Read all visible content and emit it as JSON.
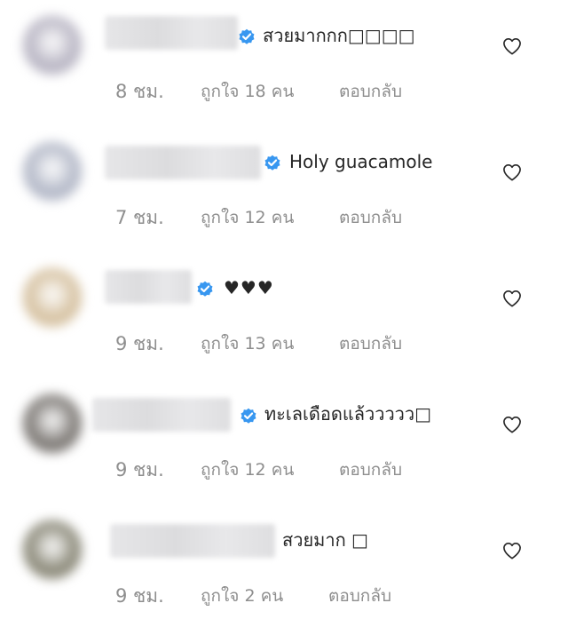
{
  "top_partial_text": "",
  "comments": [
    {
      "text": "สวยมากกก□□□□",
      "verified": true,
      "time": "8 ชม.",
      "likes": "ถูกใจ 18 คน",
      "reply": "ตอบกลับ",
      "avatar_color": "#b9b6c4"
    },
    {
      "text": "Holy guacamole",
      "verified": true,
      "time": "7 ชม.",
      "likes": "ถูกใจ 12 คน",
      "reply": "ตอบกลับ",
      "avatar_color": "#b4b9c8"
    },
    {
      "text": "♥♥♥",
      "verified": true,
      "time": "9 ชม.",
      "likes": "ถูกใจ 13 คน",
      "reply": "ตอบกลับ",
      "avatar_color": "#d6c2a2"
    },
    {
      "text": "ทะเลเดือดแล้ววววว□",
      "verified": true,
      "time": "9 ชม.",
      "likes": "ถูกใจ 12 คน",
      "reply": "ตอบกลับ",
      "avatar_color": "#7e7a76"
    },
    {
      "text": "สวยมาก □",
      "verified": false,
      "time": "9 ชม.",
      "likes": "ถูกใจ 2 คน",
      "reply": "ตอบกลับ",
      "avatar_color": "#8c8a7a"
    }
  ],
  "colors": {
    "verified_blue": "#3897f0",
    "meta_gray": "#8e8e8e",
    "text": "#262626"
  },
  "icons": {
    "verified": "verified-badge-icon",
    "like": "heart-outline-icon"
  }
}
